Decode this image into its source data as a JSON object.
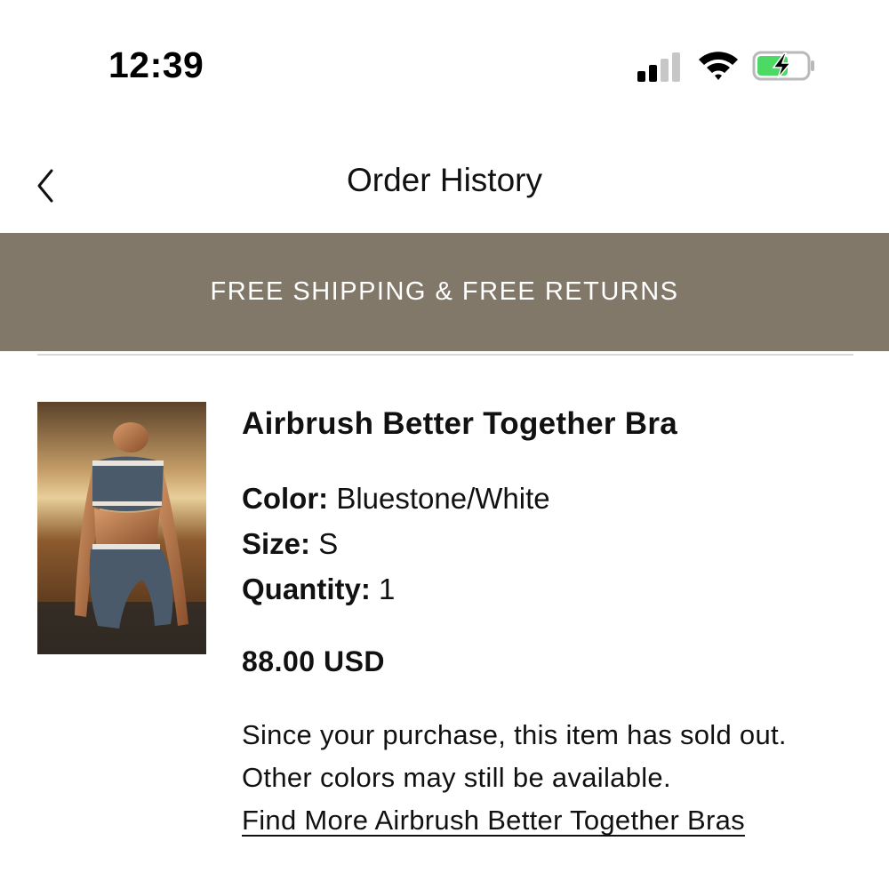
{
  "status_bar": {
    "time": "12:39",
    "icons": [
      "cellular-signal-icon",
      "wifi-icon",
      "battery-charging-icon"
    ],
    "battery_color": "#4cd964"
  },
  "header": {
    "title": "Order History",
    "back_icon": "chevron-left-icon"
  },
  "promo_banner": {
    "text": "FREE SHIPPING & FREE RETURNS",
    "background": "#817869"
  },
  "order_item": {
    "name": "Airbrush Better Together Bra",
    "attributes": [
      {
        "label": "Color:",
        "value": "Bluestone/White"
      },
      {
        "label": "Size:",
        "value": "S"
      },
      {
        "label": "Quantity:",
        "value": "1"
      }
    ],
    "price": "88.00 USD",
    "notice": "Since your purchase, this item has sold out. Other colors may still be available.",
    "link_text": "Find More Airbrush Better Together Bras"
  }
}
